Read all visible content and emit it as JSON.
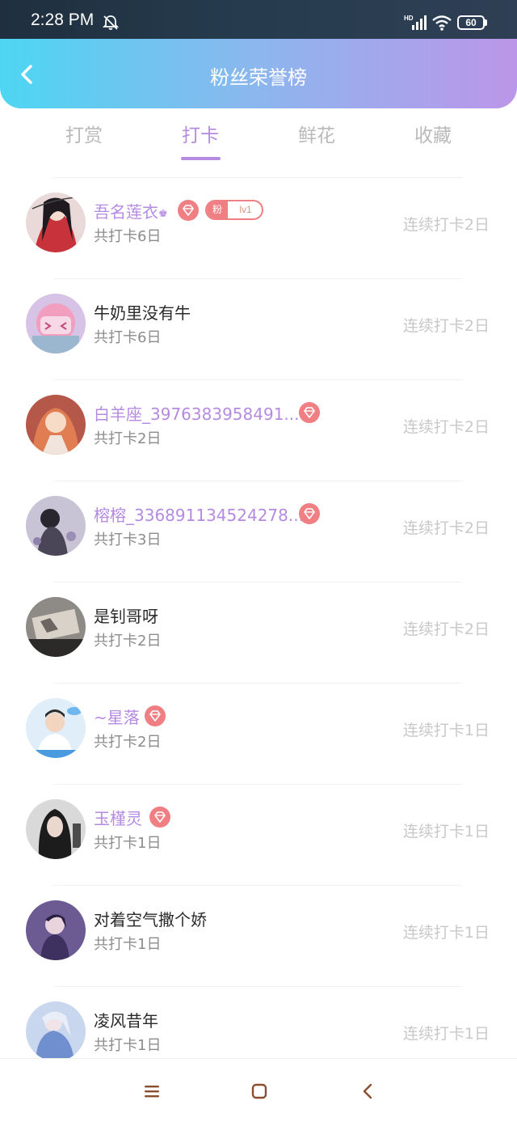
{
  "status_bar": {
    "time": "2:28 PM",
    "battery_level": "60",
    "icons": [
      "bell-muted-icon",
      "hd-signal-icon",
      "wifi-icon",
      "battery-icon"
    ]
  },
  "header": {
    "title": "粉丝荣誉榜",
    "back_icon": "chevron-left-icon"
  },
  "tabs": [
    {
      "label": "打赏",
      "active": false
    },
    {
      "label": "打卡",
      "active": true
    },
    {
      "label": "鲜花",
      "active": false
    },
    {
      "label": "收藏",
      "active": false
    }
  ],
  "list": [
    {
      "name": "吾名莲衣",
      "vip": true,
      "crown": "♚",
      "gem": true,
      "fan_badge": {
        "label": "粉",
        "level": "lv1"
      },
      "total": "共打卡6日",
      "streak": "连续打卡2日"
    },
    {
      "name": "牛奶里没有牛",
      "vip": false,
      "gem": false,
      "total": "共打卡6日",
      "streak": "连续打卡2日"
    },
    {
      "name": "白羊座_3976383958491...",
      "vip": true,
      "gem": true,
      "total": "共打卡2日",
      "streak": "连续打卡2日"
    },
    {
      "name": "榕榕_336891134524278...",
      "vip": true,
      "gem": true,
      "total": "共打卡3日",
      "streak": "连续打卡2日"
    },
    {
      "name": "是钊哥呀",
      "vip": false,
      "gem": false,
      "total": "共打卡2日",
      "streak": "连续打卡2日"
    },
    {
      "name": "~星落",
      "vip": true,
      "gem": true,
      "total": "共打卡2日",
      "streak": "连续打卡1日"
    },
    {
      "name": "玉槿灵",
      "vip": true,
      "gem": true,
      "total": "共打卡1日",
      "streak": "连续打卡1日"
    },
    {
      "name": "对着空气撒个娇",
      "vip": false,
      "gem": false,
      "total": "共打卡1日",
      "streak": "连续打卡1日"
    },
    {
      "name": "凌风昔年",
      "vip": false,
      "gem": false,
      "total": "共打卡1日",
      "streak": "连续打卡1日"
    }
  ],
  "colors": {
    "accent": "#b58be2",
    "badge": "#f07f84",
    "header_start": "#4dd6f2",
    "header_end": "#bc96e8"
  },
  "nav_bar": {
    "icons": [
      "menu-icon",
      "home-icon",
      "back-icon"
    ]
  }
}
